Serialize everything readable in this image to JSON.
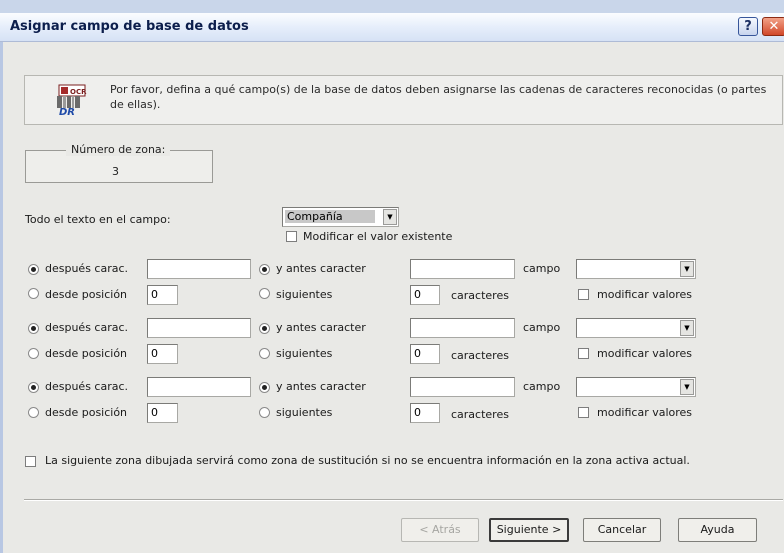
{
  "window": {
    "title": "Asignar campo de base de datos",
    "help_label": "?",
    "close_label": "✕"
  },
  "info": {
    "icon": "ocr-logo-icon",
    "text": "Por favor, defina a qué campo(s) de la base de datos deben asignarse las cadenas de caracteres reconocidas (o partes de ellas)."
  },
  "zone": {
    "label": "Número de zona:",
    "value": "3"
  },
  "all_text": {
    "label": "Todo el texto en el campo:",
    "selected": "Compañía",
    "modify_label": "Modificar el valor existente",
    "modify_checked": false
  },
  "rules": [
    {
      "after_label": "después carac.",
      "after_selected": true,
      "after_value": "",
      "from_label": "desde posición",
      "from_value": "0",
      "before_label": "y antes caracter",
      "before_selected": true,
      "before_value": "",
      "next_label": "siguientes",
      "next_value": "0",
      "chars_label": "caracteres",
      "field_label": "campo",
      "field_value": "",
      "modify_label": "modificar valores",
      "modify_checked": false
    },
    {
      "after_label": "después carac.",
      "after_selected": true,
      "after_value": "",
      "from_label": "desde posición",
      "from_value": "0",
      "before_label": "y antes caracter",
      "before_selected": true,
      "before_value": "",
      "next_label": "siguientes",
      "next_value": "0",
      "chars_label": "caracteres",
      "field_label": "campo",
      "field_value": "",
      "modify_label": "modificar valores",
      "modify_checked": false
    },
    {
      "after_label": "después carac.",
      "after_selected": true,
      "after_value": "",
      "from_label": "desde posición",
      "from_value": "0",
      "before_label": "y antes caracter",
      "before_selected": true,
      "before_value": "",
      "next_label": "siguientes",
      "next_value": "0",
      "chars_label": "caracteres",
      "field_label": "campo",
      "field_value": "",
      "modify_label": "modificar valores",
      "modify_checked": false
    }
  ],
  "substitution": {
    "label": "La siguiente zona dibujada servirá como zona de sustitución si no se encuentra información en la zona activa actual.",
    "checked": false
  },
  "buttons": {
    "back": "< Atrás",
    "next": "Siguiente >",
    "cancel": "Cancelar",
    "help": "Ayuda"
  }
}
